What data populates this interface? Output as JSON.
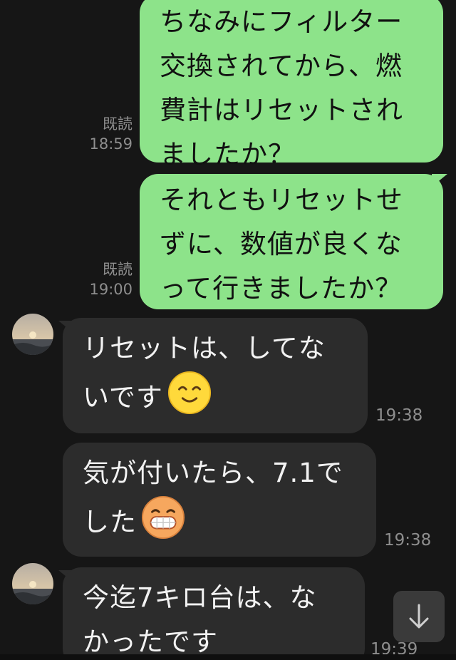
{
  "messages": [
    {
      "id": "m1",
      "side": "out",
      "lines": [
        "ちなみにフィルター",
        "交換されてから、燃",
        "費計はリセットされ",
        "ましたか？"
      ],
      "read_label": "既読",
      "time": "18:59"
    },
    {
      "id": "m2",
      "side": "out",
      "lines": [
        "それともリセットせ",
        "ずに、数値が良くな",
        "って行きましたか？"
      ],
      "read_label": "既読",
      "time": "19:00"
    },
    {
      "id": "m3",
      "side": "in",
      "lines": [
        "リセットは、してな",
        "いです"
      ],
      "emoji": "smiling-face-emoji",
      "time": "19:38"
    },
    {
      "id": "m4",
      "side": "in",
      "lines": [
        "気が付いたら、7.1で",
        "した"
      ],
      "emoji": "grinning-face-emoji",
      "time": "19:38"
    },
    {
      "id": "m5",
      "side": "in",
      "lines": [
        "今迄7キロ台は、な",
        "かったです"
      ],
      "time": "19:39"
    }
  ],
  "scroll_button_icon": "arrow-down-icon",
  "colors": {
    "background": "#161616",
    "outgoing_bubble": "#8de38a",
    "incoming_bubble": "#2c2c2c",
    "meta_text": "#8e8e8e"
  }
}
